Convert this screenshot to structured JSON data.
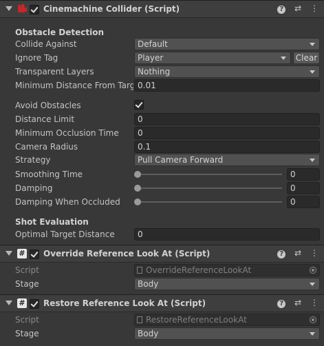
{
  "collider": {
    "title": "Cinemachine Collider (Script)",
    "enabled": true,
    "section_obstacle": "Obstacle Detection",
    "collide_against_label": "Collide Against",
    "collide_against_value": "Default",
    "ignore_tag_label": "Ignore Tag",
    "ignore_tag_value": "Player",
    "clear_label": "Clear",
    "transparent_layers_label": "Transparent Layers",
    "transparent_layers_value": "Nothing",
    "min_distance_label": "Minimum Distance From Targe",
    "min_distance_value": "0.01",
    "avoid_obstacles_label": "Avoid Obstacles",
    "avoid_obstacles_checked": true,
    "distance_limit_label": "Distance Limit",
    "distance_limit_value": "0",
    "min_occlusion_label": "Minimum Occlusion Time",
    "min_occlusion_value": "0",
    "camera_radius_label": "Camera Radius",
    "camera_radius_value": "0.1",
    "strategy_label": "Strategy",
    "strategy_value": "Pull Camera Forward",
    "smoothing_label": "Smoothing Time",
    "smoothing_value": "0",
    "damping_label": "Damping",
    "damping_value": "0",
    "damping_occluded_label": "Damping When Occluded",
    "damping_occluded_value": "0",
    "section_shot": "Shot Evaluation",
    "optimal_distance_label": "Optimal Target Distance",
    "optimal_distance_value": "0"
  },
  "override": {
    "title": "Override Reference Look At (Script)",
    "enabled": true,
    "script_label": "Script",
    "script_value": "OverrideReferenceLookAt",
    "stage_label": "Stage",
    "stage_value": "Body"
  },
  "restore": {
    "title": "Restore Reference Look At (Script)",
    "enabled": true,
    "script_label": "Script",
    "script_value": "RestoreReferenceLookAt",
    "stage_label": "Stage",
    "stage_value": "Body"
  },
  "header_icons": [
    "help-icon",
    "presets-icon",
    "kebab-menu-icon"
  ],
  "header_glyphs": {
    "help": "?",
    "presets": "⇄",
    "menu": "⋮",
    "script": "#"
  },
  "colors": {
    "background": "#383838",
    "header": "#3e3e3e",
    "field": "#2a2a2a",
    "dropdown": "#515151"
  }
}
